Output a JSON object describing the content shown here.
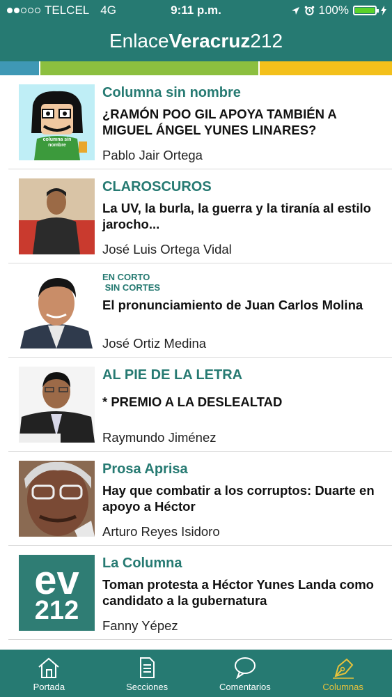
{
  "status": {
    "carrier": "TELCEL",
    "network": "4G",
    "time": "9:11 p.m.",
    "battery": "100%",
    "battery_level": 1.0,
    "signal_bars": 2
  },
  "header": {
    "title_pre": "Enlace",
    "title_bold": "Veracruz",
    "title_post": "212"
  },
  "colors": {
    "brand": "#267a72",
    "bar_blue": "#3f98b5",
    "bar_green": "#8cbf3f",
    "bar_yellow": "#f3c01b",
    "active_tab": "#e8c23b"
  },
  "columns": [
    {
      "column": "Columna sin nombre",
      "headline": "¿RAMÓN POO GIL APOYA TAMBIÉN A MIGUEL ÁNGEL YUNES LINARES?",
      "author": "Pablo Jair Ortega",
      "thumb_text": "columna sin nombre"
    },
    {
      "column": "CLAROSCUROS",
      "headline": "La UV, la burla, la guerra y la tiranía al estilo jarocho...",
      "author": "José Luis Ortega Vidal"
    },
    {
      "column": "EN CORTO\n SIN CORTES",
      "headline": "El pronunciamiento de Juan Carlos Molina",
      "author": "José Ortiz Medina"
    },
    {
      "column": "AL PIE DE LA LETRA",
      "headline": "* PREMIO A LA DESLEALTAD",
      "author": "Raymundo Jiménez"
    },
    {
      "column": "Prosa Aprisa",
      "headline": "Hay que combatir a los corruptos: Duarte en apoyo a Héctor",
      "author": "Arturo Reyes Isidoro"
    },
    {
      "column": "La Columna",
      "headline": "Toman protesta a Héctor Yunes Landa como candidato a la gubernatura",
      "author": "Fanny Yépez",
      "logo_top": "ev",
      "logo_bottom": "212"
    }
  ],
  "tabs": [
    {
      "label": "Portada",
      "icon": "house-icon"
    },
    {
      "label": "Secciones",
      "icon": "document-icon"
    },
    {
      "label": "Comentarios",
      "icon": "speech-bubble-icon"
    },
    {
      "label": "Columnas",
      "icon": "pen-nib-icon",
      "active": true
    }
  ]
}
